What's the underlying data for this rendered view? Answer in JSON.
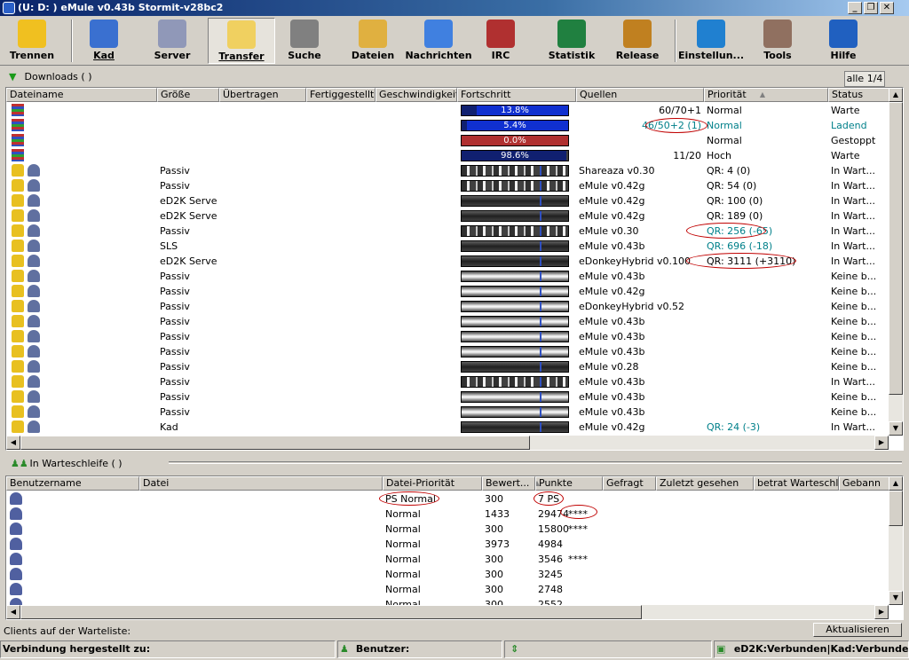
{
  "window": {
    "title": "(U:      D:      ) eMule v0.43b Stormit-v28bc2"
  },
  "toolbar": {
    "items": [
      {
        "label": "Trennen",
        "icon": "disconnect-icon",
        "color": "#f0c020"
      },
      {
        "label": "Kad",
        "icon": "kad-network-icon",
        "color": "#3a70d0"
      },
      {
        "label": "Server",
        "icon": "server-icon",
        "color": "#9098b8"
      },
      {
        "label": "Transfer",
        "icon": "transfer-icon",
        "color": "#f0d060"
      },
      {
        "label": "Suche",
        "icon": "search-icon",
        "color": "#808080"
      },
      {
        "label": "Dateien",
        "icon": "shared-files-icon",
        "color": "#e0b040"
      },
      {
        "label": "Nachrichten",
        "icon": "messages-icon",
        "color": "#4080e0"
      },
      {
        "label": "IRC",
        "icon": "irc-icon",
        "color": "#b03030"
      },
      {
        "label": "Statistik",
        "icon": "statistics-icon",
        "color": "#208040"
      },
      {
        "label": "Release",
        "icon": "release-icon",
        "color": "#c08020"
      },
      {
        "label": "Einstellun...",
        "icon": "settings-gear-icon",
        "color": "#2080d0"
      },
      {
        "label": "Tools",
        "icon": "tools-icon",
        "color": "#907060"
      },
      {
        "label": "Hilfe",
        "icon": "help-icon",
        "color": "#2060c0"
      }
    ],
    "active_index": 3
  },
  "downloads": {
    "title": "Downloads ( )",
    "tab_label": "alle 1/4",
    "columns": [
      "Dateiname",
      "Größe",
      "Übertragen",
      "Fertiggestellt",
      "Geschwindigkeit",
      "Fortschritt",
      "Quellen",
      "Priorität",
      "Status"
    ],
    "rows": [
      {
        "type": "file",
        "size": "",
        "progress": 13.8,
        "progress_label": "13.8%",
        "bar_color": "#1030d0",
        "sources": "60/70+1",
        "sources_circled": false,
        "priority": "Normal",
        "priority_teal": false,
        "status": "Warte",
        "status_teal": false
      },
      {
        "type": "file",
        "size": "",
        "progress": 5.4,
        "progress_label": "5.4%",
        "bar_color": "#1030d0",
        "sources": "46/50+2 (1)",
        "sources_circled": true,
        "priority": "Normal",
        "priority_teal": true,
        "status": "Ladend",
        "status_teal": true
      },
      {
        "type": "file",
        "size": "",
        "progress": 0.0,
        "progress_label": "0.0%",
        "bar_color": "#b03030",
        "sources": "",
        "sources_circled": false,
        "priority": "Normal",
        "priority_teal": false,
        "status": "Gestoppt",
        "status_teal": false
      },
      {
        "type": "file",
        "size": "",
        "progress": 98.6,
        "progress_label": "98.6%",
        "bar_color": "#404040",
        "sources": "11/20",
        "sources_circled": false,
        "priority": "Hoch",
        "priority_teal": false,
        "status": "Warte",
        "status_teal": false
      },
      {
        "type": "source",
        "size": "Passiv",
        "client": "Shareaza v0.30",
        "priority": "QR: 4 (0)",
        "priority_teal": false,
        "circled": false,
        "status": "In Wart...",
        "bar_style": "stripes"
      },
      {
        "type": "source",
        "size": "Passiv",
        "client": "eMule v0.42g",
        "priority": "QR: 54 (0)",
        "priority_teal": false,
        "circled": false,
        "status": "In Wart...",
        "bar_style": "stripes"
      },
      {
        "type": "source",
        "size": "eD2K Server",
        "client": "eMule v0.42g",
        "priority": "QR: 100 (0)",
        "priority_teal": false,
        "circled": false,
        "status": "In Wart...",
        "bar_style": "dark"
      },
      {
        "type": "source",
        "size": "eD2K Server",
        "client": "eMule v0.42g",
        "priority": "QR: 189 (0)",
        "priority_teal": false,
        "circled": false,
        "status": "In Wart...",
        "bar_style": "dark"
      },
      {
        "type": "source",
        "size": "Passiv",
        "client": "eMule v0.30",
        "priority": "QR: 256 (-65)",
        "priority_teal": true,
        "circled": true,
        "status": "In Wart...",
        "bar_style": "stripes"
      },
      {
        "type": "source",
        "size": "SLS",
        "client": "eMule v0.43b",
        "priority": "QR: 696 (-18)",
        "priority_teal": true,
        "circled": false,
        "status": "In Wart...",
        "bar_style": "dark"
      },
      {
        "type": "source",
        "size": "eD2K Server",
        "client": "eDonkeyHybrid v0.100",
        "priority": "QR: 3111 (+3110)",
        "priority_teal": false,
        "circled": true,
        "status": "In Wart...",
        "bar_style": "dark"
      },
      {
        "type": "source",
        "size": "Passiv",
        "client": "eMule v0.43b",
        "priority": "",
        "priority_teal": false,
        "circled": false,
        "status": "Keine b...",
        "bar_style": "gray"
      },
      {
        "type": "source",
        "size": "Passiv",
        "client": "eMule v0.42g",
        "priority": "",
        "priority_teal": false,
        "circled": false,
        "status": "Keine b...",
        "bar_style": "gray"
      },
      {
        "type": "source",
        "size": "Passiv",
        "client": "eDonkeyHybrid v0.52",
        "priority": "",
        "priority_teal": false,
        "circled": false,
        "status": "Keine b...",
        "bar_style": "gray"
      },
      {
        "type": "source",
        "size": "Passiv",
        "client": "eMule v0.43b",
        "priority": "",
        "priority_teal": false,
        "circled": false,
        "status": "Keine b...",
        "bar_style": "gray"
      },
      {
        "type": "source",
        "size": "Passiv",
        "client": "eMule v0.43b",
        "priority": "",
        "priority_teal": false,
        "circled": false,
        "status": "Keine b...",
        "bar_style": "gray"
      },
      {
        "type": "source",
        "size": "Passiv",
        "client": "eMule v0.43b",
        "priority": "",
        "priority_teal": false,
        "circled": false,
        "status": "Keine b...",
        "bar_style": "gray"
      },
      {
        "type": "source",
        "size": "Passiv",
        "client": "eMule v0.28",
        "priority": "",
        "priority_teal": false,
        "circled": false,
        "status": "Keine b...",
        "bar_style": "dark"
      },
      {
        "type": "source",
        "size": "Passiv",
        "client": "eMule v0.43b",
        "priority": "",
        "priority_teal": false,
        "circled": false,
        "status": "In Wart...",
        "bar_style": "stripes"
      },
      {
        "type": "source",
        "size": "Passiv",
        "client": "eMule v0.43b",
        "priority": "",
        "priority_teal": false,
        "circled": false,
        "status": "Keine b...",
        "bar_style": "gray"
      },
      {
        "type": "source",
        "size": "Passiv",
        "client": "eMule v0.43b",
        "priority": "",
        "priority_teal": false,
        "circled": false,
        "status": "Keine b...",
        "bar_style": "gray"
      },
      {
        "type": "source",
        "size": "Kad",
        "client": "eMule v0.42g",
        "priority": "QR: 24 (-3)",
        "priority_teal": true,
        "circled": false,
        "status": "In Wart...",
        "bar_style": "dark"
      }
    ]
  },
  "queue": {
    "title": "In Warteschleife ( )",
    "columns": [
      "Benutzername",
      "Datei",
      "Datei-Priorität",
      "Bewert...",
      "Punkte",
      "Gefragt",
      "Zuletzt gesehen",
      "betrat Warteschl...",
      "Gebann"
    ],
    "rows": [
      {
        "priority": "PS Normal",
        "rating": "300",
        "points": "7 PS",
        "stars": "",
        "circled": true
      },
      {
        "priority": "Normal",
        "rating": "1433",
        "points": "29474",
        "stars": "****",
        "circled": true
      },
      {
        "priority": "Normal",
        "rating": "300",
        "points": "15800",
        "stars": "****",
        "circled": false
      },
      {
        "priority": "Normal",
        "rating": "3973",
        "points": "4984",
        "stars": "",
        "circled": false
      },
      {
        "priority": "Normal",
        "rating": "300",
        "points": "3546",
        "stars": "****",
        "circled": false
      },
      {
        "priority": "Normal",
        "rating": "300",
        "points": "3245",
        "stars": "",
        "circled": false
      },
      {
        "priority": "Normal",
        "rating": "300",
        "points": "2748",
        "stars": "",
        "circled": false
      },
      {
        "priority": "Normal",
        "rating": "300",
        "points": "2552",
        "stars": "",
        "circled": false
      }
    ]
  },
  "footer": {
    "clients_label": "Clients auf der Warteliste:",
    "refresh_button": "Aktualisieren"
  },
  "statusbar": {
    "connection": "Verbindung hergestellt zu:",
    "users": "Benutzer:",
    "network": "eD2K:Verbunden|Kad:Verbunden"
  }
}
